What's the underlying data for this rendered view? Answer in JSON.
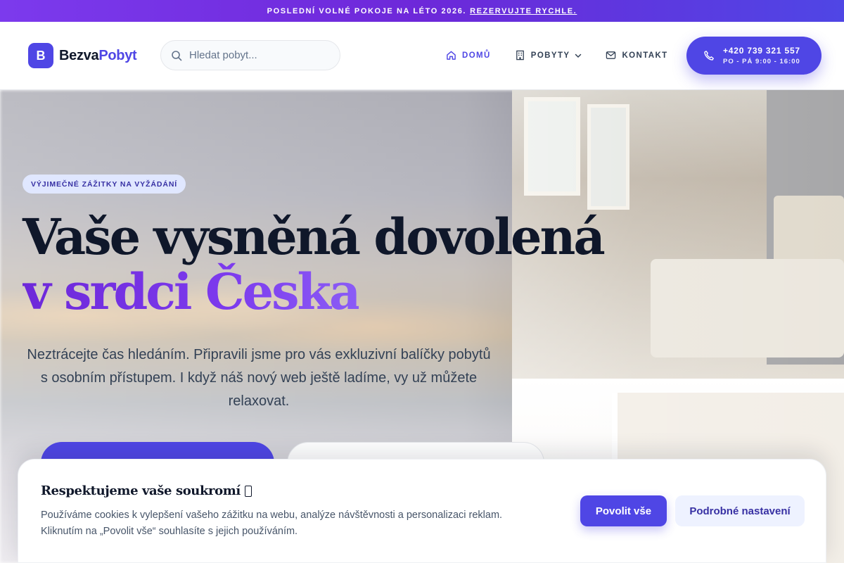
{
  "announcement": {
    "text": "POSLEDNÍ VOLNÉ POKOJE NA LÉTO 2026.",
    "link": "REZERVUJTE RYCHLE."
  },
  "header": {
    "logo_badge": "B",
    "logo_part1": "Bezva",
    "logo_part2": "Pobyt",
    "search_placeholder": "Hledat pobyt...",
    "nav": [
      {
        "label": "DOMŮ",
        "icon": "home-icon",
        "active": true
      },
      {
        "label": "POBYTY",
        "icon": "building-icon",
        "dropdown": true
      },
      {
        "label": "KONTAKT",
        "icon": "mail-icon"
      }
    ],
    "phone": {
      "number": "+420 739 321 557",
      "hours": "PO - PÁ 9:00 - 16:00"
    }
  },
  "hero": {
    "badge": "VÝJIMEČNÉ ZÁŽITKY NA VYŽÁDÁNÍ",
    "headline_line1": "Vaše vysněná dovolená",
    "headline_line2": "v srdci Česka",
    "lead": "Neztrácejte čas hledáním. Připravili jsme pro vás exkluzivní balíčky pobytů s osobním přístupem. I když náš nový web ještě ladíme, vy už můžete relaxovat."
  },
  "cookie": {
    "title": "Respektujeme vaše soukromí",
    "text": "Používáme cookies k vylepšení vašeho zážitku na webu, analýze návštěvnosti a personalizaci reklam. Kliknutím na „Povolit vše“ souhlasíte s jejich používáním.",
    "allow_label": "Povolit vše",
    "settings_label": "Podrobné nastavení"
  },
  "colors": {
    "primary": "#4f46e5",
    "accent_violet": "#7c3aed",
    "text_dark": "#0f172a"
  }
}
